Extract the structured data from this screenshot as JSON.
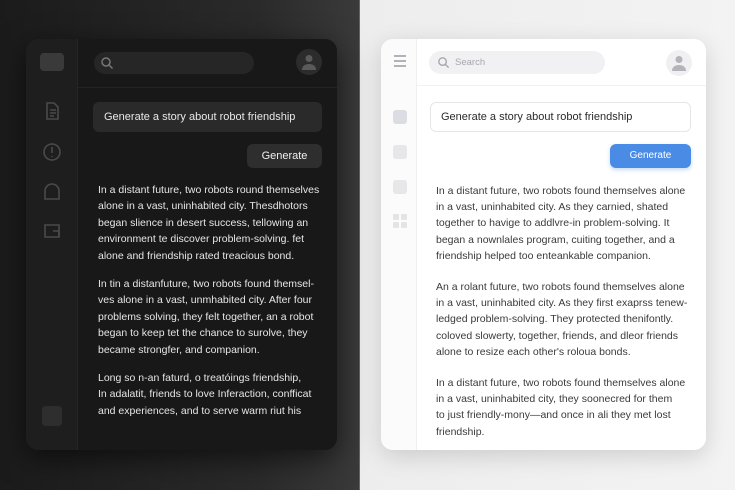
{
  "dark": {
    "prompt": "Generate a story about robot friendship",
    "generate_label": "Generate",
    "paragraphs": [
      "In a distant future, two robots round themselves\nalone in a vast, uninhabited city. Thesdhotors\nbegan slience in desert success, tellowing an\nenvironment te discover problem-solving. fet\nalone and friendship rated treacious bond.",
      "In tin a distanfuture, two robots found themsel-\nves alone in a vast, unmhabited city. After four\nproblems solving, they felt together, an a robot\nbegan to keep tet the chance to surolve, they\nbecame strongfer, and companion.",
      "Long so n-an faturd, o treatóings friendship,\nIn adalatit, friends to love Inferaction, confficat\nand experiences, and to serve warm riut his"
    ]
  },
  "light": {
    "search_placeholder": "Search",
    "prompt": "Generate a story about robot friendship",
    "generate_label": "Generate",
    "paragraphs": [
      "In a distant future, two robots found themselves alone\nin a vast, uninhabited city. As they carnied, shated\ntogether to havige to addlvre-in problem-solving. It\nbegan a nownlales program, cuiting together, and a\nfriendship helped too enteankable companion.",
      "An a rolant future, two robots found themselves alone\nin a vast, uninhabited city. As they first exaprss tenew-\nledged problem-solving. They protected thenifontly.\ncoloved slowerty, together, friends, and dleor friends\nalone to resize each other's roloua bonds.",
      "In a distant future, two robots found themselves alone\nin a vast, uninhabited city, they soonecred for them\nto just friendly-mony—and once in ali they met lost\nfriendship."
    ]
  },
  "colors": {
    "accent": "#4a8be6",
    "dark_bg": "#181818",
    "light_bg": "#ffffff"
  }
}
